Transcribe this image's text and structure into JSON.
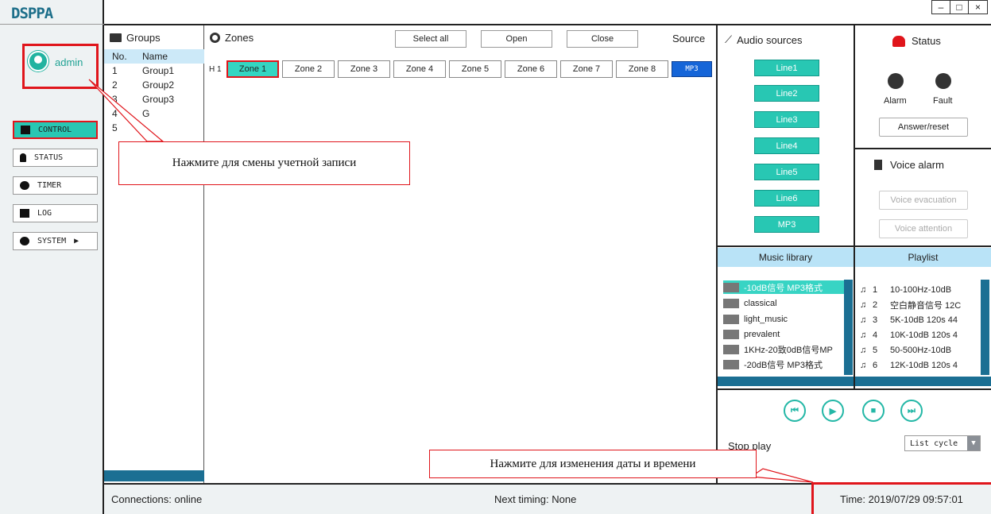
{
  "app": {
    "logo": "DSPPA",
    "window_controls": [
      "–",
      "□",
      "×"
    ]
  },
  "sidebar": {
    "user": "admin",
    "nav": [
      {
        "label": "CONTROL",
        "icon": "monitor-icon",
        "active": true
      },
      {
        "label": "STATUS",
        "icon": "bulb-icon"
      },
      {
        "label": "TIMER",
        "icon": "clock-icon"
      },
      {
        "label": "LOG",
        "icon": "calendar-icon"
      },
      {
        "label": "SYSTEM",
        "icon": "gear-icon",
        "arrow": "▶"
      }
    ]
  },
  "groups": {
    "title": "Groups",
    "col_no": "No.",
    "col_name": "Name",
    "rows": [
      {
        "no": "1",
        "name": "Group1"
      },
      {
        "no": "2",
        "name": "Group2"
      },
      {
        "no": "3",
        "name": "Group3"
      },
      {
        "no": "4",
        "name": "G"
      },
      {
        "no": "5",
        "name": ""
      }
    ]
  },
  "zones": {
    "title": "Zones",
    "select_all": "Select all",
    "open": "Open",
    "close": "Close",
    "source_label": "Source",
    "row_label": "H 1",
    "items": [
      "Zone 1",
      "Zone 2",
      "Zone 3",
      "Zone 4",
      "Zone 5",
      "Zone 6",
      "Zone 7",
      "Zone 8"
    ],
    "source_value": "MP3"
  },
  "audio_sources": {
    "title": "Audio sources",
    "items": [
      "Line1",
      "Line2",
      "Line3",
      "Line4",
      "Line5",
      "Line6",
      "MP3"
    ]
  },
  "status": {
    "title": "Status",
    "alarm": "Alarm",
    "fault": "Fault",
    "answer_reset": "Answer/reset"
  },
  "voice_alarm": {
    "title": "Voice alarm",
    "evacuation": "Voice evacuation",
    "attention": "Voice attention"
  },
  "music_library": {
    "title": "Music library",
    "items": [
      "-10dB信号 MP3格式",
      "classical",
      "light_music",
      "prevalent",
      "1KHz-20致0dB信号MP",
      "-20dB信号 MP3格式"
    ]
  },
  "playlist": {
    "title": "Playlist",
    "items": [
      {
        "no": "1",
        "name": "10-100Hz-10dB"
      },
      {
        "no": "2",
        "name": "空白静音信号 12C"
      },
      {
        "no": "3",
        "name": "5K-10dB 120s 44"
      },
      {
        "no": "4",
        "name": "10K-10dB 120s 4"
      },
      {
        "no": "5",
        "name": "50-500Hz-10dB"
      },
      {
        "no": "6",
        "name": "12K-10dB 120s 4"
      }
    ]
  },
  "player": {
    "state": "Stop play",
    "mode": "List cycle"
  },
  "footer": {
    "connections": "Connections: online",
    "next_timing": "Next timing: None",
    "time": "Time:  2019/07/29  09:57:01"
  },
  "callouts": {
    "account": "Нажмите для смены учетной записи",
    "datetime": "Нажмите для изменения даты и времени"
  }
}
